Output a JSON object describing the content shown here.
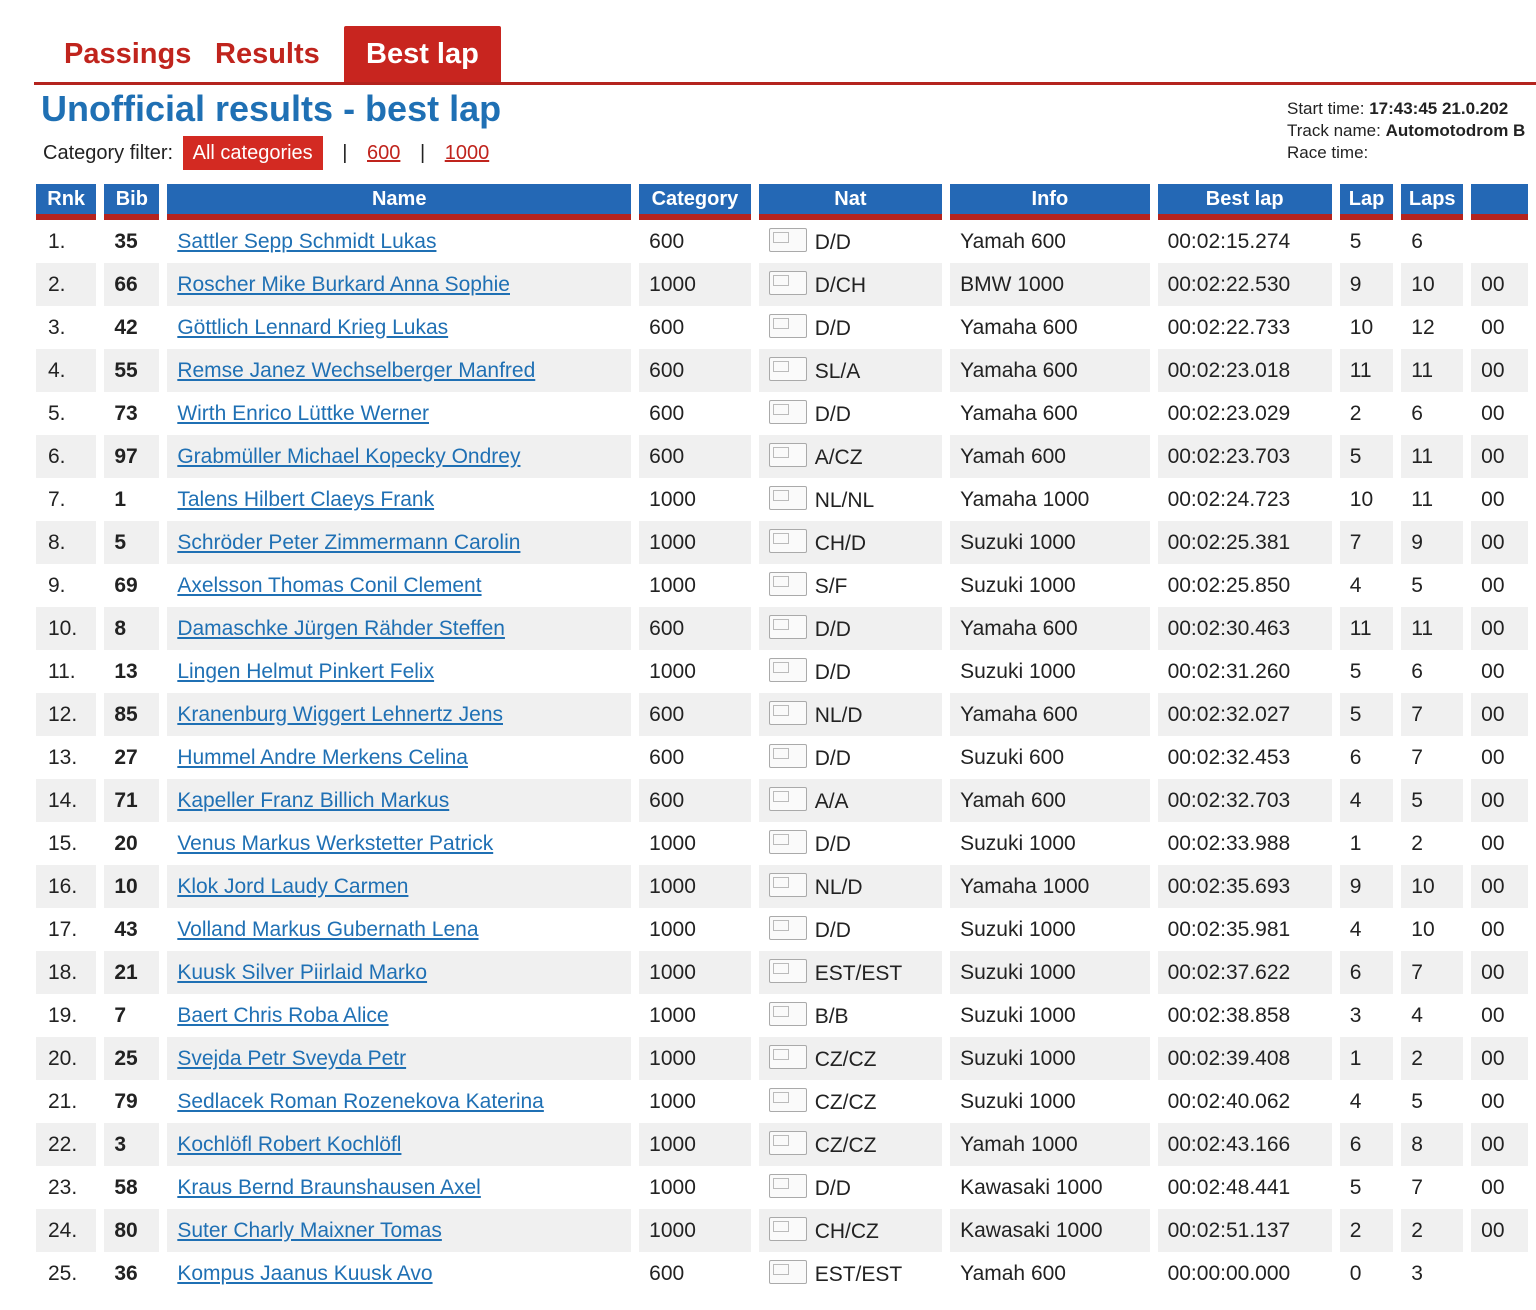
{
  "tabs": [
    {
      "label": "Passings"
    },
    {
      "label": "Results"
    },
    {
      "label": "Best lap"
    }
  ],
  "active_tab": "Best lap",
  "title": "Unofficial results - best lap",
  "filter": {
    "label": "Category filter:",
    "options": [
      "All categories",
      "600",
      "1000"
    ],
    "separator": "|"
  },
  "meta": {
    "start_label": "Start time:",
    "start_value": "17:43:45 21.0.202",
    "track_label": "Track name:",
    "track_value": "Automotodrom B",
    "race_label": "Race time:"
  },
  "columns": [
    "Rnk",
    "Bib",
    "Name",
    "Category",
    "Nat",
    "Info",
    "Best lap",
    "Lap",
    "Laps",
    ""
  ],
  "rows": [
    {
      "rnk": "1.",
      "bib": "35",
      "name": "Sattler Sepp Schmidt Lukas",
      "cat": "600",
      "nat": "D/D",
      "info": "Yamah 600",
      "best": "00:02:15.274",
      "lap": "5",
      "laps": "6",
      "extra": ""
    },
    {
      "rnk": "2.",
      "bib": "66",
      "name": "Roscher Mike Burkard Anna Sophie",
      "cat": "1000",
      "nat": "D/CH",
      "info": "BMW 1000",
      "best": "00:02:22.530",
      "lap": "9",
      "laps": "10",
      "extra": "00"
    },
    {
      "rnk": "3.",
      "bib": "42",
      "name": "Göttlich Lennard Krieg Lukas",
      "cat": "600",
      "nat": "D/D",
      "info": "Yamaha 600",
      "best": "00:02:22.733",
      "lap": "10",
      "laps": "12",
      "extra": "00"
    },
    {
      "rnk": "4.",
      "bib": "55",
      "name": "Remse Janez Wechselberger Manfred",
      "cat": "600",
      "nat": "SL/A",
      "info": "Yamaha 600",
      "best": "00:02:23.018",
      "lap": "11",
      "laps": "11",
      "extra": "00"
    },
    {
      "rnk": "5.",
      "bib": "73",
      "name": "Wirth Enrico Lüttke Werner",
      "cat": "600",
      "nat": "D/D",
      "info": "Yamaha 600",
      "best": "00:02:23.029",
      "lap": "2",
      "laps": "6",
      "extra": "00"
    },
    {
      "rnk": "6.",
      "bib": "97",
      "name": "Grabmüller Michael Kopecky Ondrey",
      "cat": "600",
      "nat": "A/CZ",
      "info": "Yamah 600",
      "best": "00:02:23.703",
      "lap": "5",
      "laps": "11",
      "extra": "00"
    },
    {
      "rnk": "7.",
      "bib": "1",
      "name": "Talens Hilbert Claeys Frank",
      "cat": "1000",
      "nat": "NL/NL",
      "info": "Yamaha 1000",
      "best": "00:02:24.723",
      "lap": "10",
      "laps": "11",
      "extra": "00"
    },
    {
      "rnk": "8.",
      "bib": "5",
      "name": "Schröder Peter Zimmermann Carolin",
      "cat": "1000",
      "nat": "CH/D",
      "info": "Suzuki 1000",
      "best": "00:02:25.381",
      "lap": "7",
      "laps": "9",
      "extra": "00"
    },
    {
      "rnk": "9.",
      "bib": "69",
      "name": "Axelsson Thomas Conil Clement",
      "cat": "1000",
      "nat": "S/F",
      "info": "Suzuki 1000",
      "best": "00:02:25.850",
      "lap": "4",
      "laps": "5",
      "extra": "00"
    },
    {
      "rnk": "10.",
      "bib": "8",
      "name": "Damaschke Jürgen Rähder Steffen",
      "cat": "600",
      "nat": "D/D",
      "info": "Yamaha 600",
      "best": "00:02:30.463",
      "lap": "11",
      "laps": "11",
      "extra": "00"
    },
    {
      "rnk": "11.",
      "bib": "13",
      "name": "Lingen Helmut Pinkert Felix",
      "cat": "1000",
      "nat": "D/D",
      "info": "Suzuki 1000",
      "best": "00:02:31.260",
      "lap": "5",
      "laps": "6",
      "extra": "00"
    },
    {
      "rnk": "12.",
      "bib": "85",
      "name": "Kranenburg Wiggert Lehnertz Jens",
      "cat": "600",
      "nat": "NL/D",
      "info": "Yamaha 600",
      "best": "00:02:32.027",
      "lap": "5",
      "laps": "7",
      "extra": "00"
    },
    {
      "rnk": "13.",
      "bib": "27",
      "name": "Hummel Andre Merkens Celina",
      "cat": "600",
      "nat": "D/D",
      "info": "Suzuki 600",
      "best": "00:02:32.453",
      "lap": "6",
      "laps": "7",
      "extra": "00"
    },
    {
      "rnk": "14.",
      "bib": "71",
      "name": "Kapeller Franz Billich Markus",
      "cat": "600",
      "nat": "A/A",
      "info": "Yamah 600",
      "best": "00:02:32.703",
      "lap": "4",
      "laps": "5",
      "extra": "00"
    },
    {
      "rnk": "15.",
      "bib": "20",
      "name": "Venus Markus Werkstetter Patrick",
      "cat": "1000",
      "nat": "D/D",
      "info": "Suzuki 1000",
      "best": "00:02:33.988",
      "lap": "1",
      "laps": "2",
      "extra": "00"
    },
    {
      "rnk": "16.",
      "bib": "10",
      "name": "Klok Jord Laudy Carmen",
      "cat": "1000",
      "nat": "NL/D",
      "info": "Yamaha 1000",
      "best": "00:02:35.693",
      "lap": "9",
      "laps": "10",
      "extra": "00"
    },
    {
      "rnk": "17.",
      "bib": "43",
      "name": "Volland Markus Gubernath Lena",
      "cat": "1000",
      "nat": "D/D",
      "info": "Suzuki 1000",
      "best": "00:02:35.981",
      "lap": "4",
      "laps": "10",
      "extra": "00"
    },
    {
      "rnk": "18.",
      "bib": "21",
      "name": "Kuusk Silver Piirlaid Marko",
      "cat": "1000",
      "nat": "EST/EST",
      "info": "Suzuki 1000",
      "best": "00:02:37.622",
      "lap": "6",
      "laps": "7",
      "extra": "00"
    },
    {
      "rnk": "19.",
      "bib": "7",
      "name": "Baert Chris Roba Alice",
      "cat": "1000",
      "nat": "B/B",
      "info": "Suzuki 1000",
      "best": "00:02:38.858",
      "lap": "3",
      "laps": "4",
      "extra": "00"
    },
    {
      "rnk": "20.",
      "bib": "25",
      "name": "Svejda Petr Sveyda Petr",
      "cat": "1000",
      "nat": "CZ/CZ",
      "info": "Suzuki 1000",
      "best": "00:02:39.408",
      "lap": "1",
      "laps": "2",
      "extra": "00"
    },
    {
      "rnk": "21.",
      "bib": "79",
      "name": "Sedlacek Roman Rozenekova Katerina",
      "cat": "1000",
      "nat": "CZ/CZ",
      "info": "Suzuki 1000",
      "best": "00:02:40.062",
      "lap": "4",
      "laps": "5",
      "extra": "00"
    },
    {
      "rnk": "22.",
      "bib": "3",
      "name": "Kochlöfl Robert Kochlöfl",
      "cat": "1000",
      "nat": "CZ/CZ",
      "info": "Yamah 1000",
      "best": "00:02:43.166",
      "lap": "6",
      "laps": "8",
      "extra": "00"
    },
    {
      "rnk": "23.",
      "bib": "58",
      "name": "Kraus Bernd Braunshausen Axel",
      "cat": "1000",
      "nat": "D/D",
      "info": "Kawasaki 1000",
      "best": "00:02:48.441",
      "lap": "5",
      "laps": "7",
      "extra": "00"
    },
    {
      "rnk": "24.",
      "bib": "80",
      "name": "Suter Charly Maixner Tomas",
      "cat": "1000",
      "nat": "CH/CZ",
      "info": "Kawasaki 1000",
      "best": "00:02:51.137",
      "lap": "2",
      "laps": "2",
      "extra": "00"
    },
    {
      "rnk": "25.",
      "bib": "36",
      "name": "Kompus Jaanus Kuusk Avo",
      "cat": "600",
      "nat": "EST/EST",
      "info": "Yamah 600",
      "best": "00:00:00.000",
      "lap": "0",
      "laps": "3",
      "extra": ""
    }
  ],
  "colors": {
    "accent_red": "#c8251f",
    "header_blue": "#2468b5",
    "link_blue": "#1f70b4",
    "row_stripe": "#f0f0f0"
  }
}
